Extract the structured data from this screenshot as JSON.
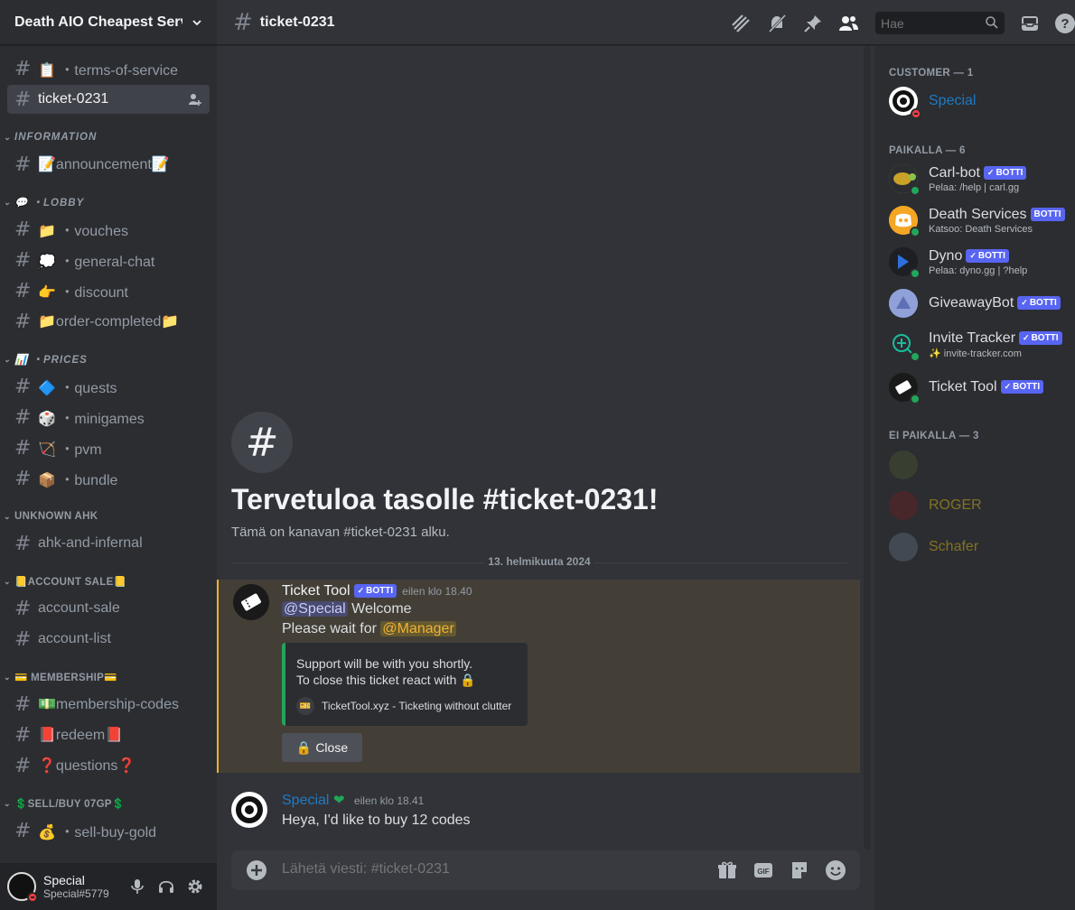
{
  "guild": {
    "name": "Death AIO Cheapest Services"
  },
  "sidebar": {
    "top_channels": [
      {
        "label": "📋 ・terms-of-service"
      },
      {
        "label": "ticket-0231"
      }
    ],
    "categories": [
      {
        "name": "INFORMATION",
        "channels": [
          {
            "label": "📝announcement📝"
          }
        ]
      },
      {
        "name": "💬 ・LOBBY",
        "channels": [
          {
            "label": "📁 ・vouches"
          },
          {
            "label": "💭 ・general-chat"
          },
          {
            "label": "👉 ・discount"
          },
          {
            "label": "📁order-completed📁"
          }
        ]
      },
      {
        "name": "📊 ・PRICES",
        "channels": [
          {
            "label": "🔷 ・quests"
          },
          {
            "label": "🎲 ・minigames"
          },
          {
            "label": "🏹 ・pvm"
          },
          {
            "label": "📦 ・bundle"
          }
        ]
      },
      {
        "name": "UNKNOWN AHK",
        "channels": [
          {
            "label": "ahk-and-infernal"
          }
        ]
      },
      {
        "name": "📒ACCOUNT SALE📒",
        "channels": [
          {
            "label": "account-sale"
          },
          {
            "label": "account-list"
          }
        ]
      },
      {
        "name": "💳 MEMBERSHIP💳",
        "channels": [
          {
            "label": "💵membership-codes"
          },
          {
            "label": "📕redeem📕"
          },
          {
            "label": "❓questions❓"
          }
        ]
      },
      {
        "name": "💲SELL/BUY 07GP💲",
        "channels": [
          {
            "label": "💰 ・sell-buy-gold"
          }
        ]
      }
    ]
  },
  "user": {
    "name": "Special",
    "tag": "Special#5779"
  },
  "topbar": {
    "channel": "ticket-0231",
    "search_placeholder": "Hae"
  },
  "chat": {
    "welcome_title": "Tervetuloa tasolle #ticket-0231!",
    "welcome_sub": "Tämä on kanavan #ticket-0231 alku.",
    "date_divider": "13. helmikuuta 2024",
    "bot_tag": "BOTTI",
    "messages": [
      {
        "author": "Ticket Tool",
        "timestamp": "eilen klo 18.40",
        "mention": "@Special",
        "line1_rest": " Welcome",
        "line2_prefix": "Please wait for ",
        "role_mention": "@Manager",
        "embed_line1": "Support will be with you shortly.",
        "embed_line2": "To close this ticket react with",
        "embed_footer": "TicketTool.xyz - Ticketing without clutter",
        "button_label": "Close"
      },
      {
        "author": "Special",
        "timestamp": "eilen klo 18.41",
        "text": "Heya, I'd like to buy 12 codes"
      }
    ]
  },
  "composer": {
    "placeholder": "Lähetä viesti: #ticket-0231"
  },
  "members": {
    "groups": [
      {
        "header": "CUSTOMER — 1"
      },
      {
        "header": "PAIKALLA — 6"
      },
      {
        "header": "EI PAIKALLA — 3"
      }
    ],
    "customer": [
      {
        "name": "Special",
        "color": "#1e7bc4"
      }
    ],
    "online": [
      {
        "name": "Carl-bot",
        "activity": "Pelaa: /help | carl.gg",
        "bot": true
      },
      {
        "name": "Death Services",
        "activity": "Katsoo: Death Services",
        "bot": true
      },
      {
        "name": "Dyno",
        "activity": "Pelaa: dyno.gg | ?help",
        "bot": true
      },
      {
        "name": "GiveawayBot",
        "activity": "",
        "bot": true
      },
      {
        "name": "Invite Tracker",
        "activity": "✨ invite-tracker.com",
        "bot": true
      },
      {
        "name": "Ticket Tool",
        "activity": "",
        "bot": true
      }
    ],
    "offline": [
      {
        "name": "",
        "color": "#e74c3c"
      },
      {
        "name": "ROGER",
        "color": "#f1c40f"
      },
      {
        "name": "Schafer",
        "color": "#f1c40f"
      }
    ]
  },
  "colors": {
    "accent": "#5865f2",
    "online": "#23a55a",
    "dnd": "#f23f43",
    "mention_highlight": "#f0b232",
    "embed_bar": "#23a55a"
  }
}
